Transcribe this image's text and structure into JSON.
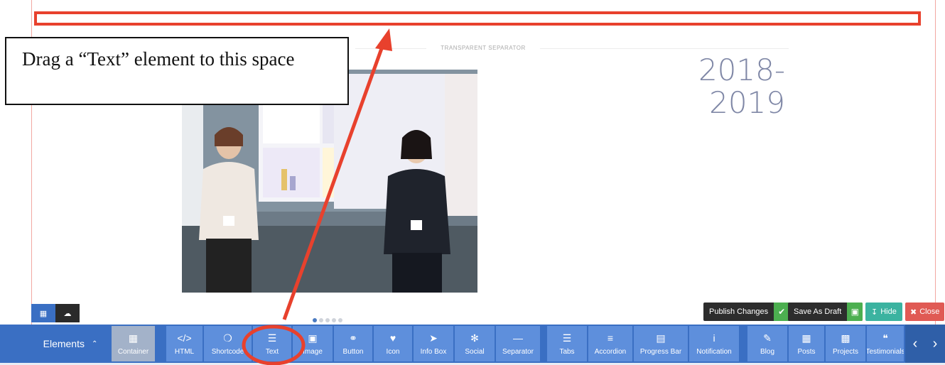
{
  "annotation": {
    "callout_text": "Drag a “Text” element to this space",
    "accent_color": "#e8412d"
  },
  "content": {
    "separator_label": "TRANSPARENT SEPARATOR",
    "year_line_1": "2018-",
    "year_line_2": "2019",
    "slider_dots_count": 5,
    "slider_active_dot": 1
  },
  "mode_tabs": [
    {
      "name": "grid-icon",
      "active": true
    },
    {
      "name": "cloud-icon",
      "active": false
    }
  ],
  "actions": {
    "publish_label": "Publish Changes",
    "save_draft_label": "Save As Draft",
    "hide_label": "Hide",
    "close_label": "Close"
  },
  "toolbar": {
    "elements_label": "Elements",
    "items": [
      {
        "label": "Container",
        "icon": "container-icon"
      },
      {
        "label": "HTML",
        "icon": "code-icon"
      },
      {
        "label": "Shortcode",
        "icon": "cube-icon"
      },
      {
        "label": "Text",
        "icon": "text-icon"
      },
      {
        "label": "Image",
        "icon": "image-icon"
      },
      {
        "label": "Button",
        "icon": "link-icon"
      },
      {
        "label": "Icon",
        "icon": "heart-icon"
      },
      {
        "label": "Info Box",
        "icon": "cursor-icon"
      },
      {
        "label": "Social",
        "icon": "twitter-icon"
      },
      {
        "label": "Separator",
        "icon": "minus-icon"
      },
      {
        "label": "Tabs",
        "icon": "list-icon"
      },
      {
        "label": "Accordion",
        "icon": "menu-icon"
      },
      {
        "label": "Progress Bar",
        "icon": "progress-icon"
      },
      {
        "label": "Notification",
        "icon": "info-icon"
      },
      {
        "label": "Blog",
        "icon": "pencil-icon"
      },
      {
        "label": "Posts",
        "icon": "grid-icon"
      },
      {
        "label": "Projects",
        "icon": "briefcase-icon"
      },
      {
        "label": "Testimonials",
        "icon": "quote-icon"
      }
    ]
  }
}
